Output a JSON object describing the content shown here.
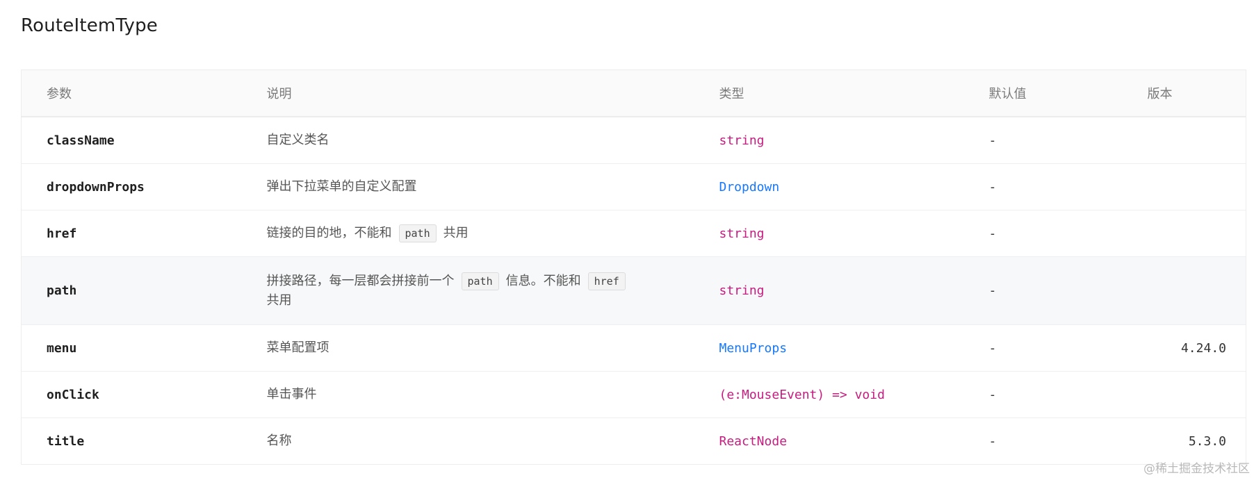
{
  "title": "RouteItemType",
  "colors": {
    "type_purple": "#c41d7f",
    "type_blue": "#1677ff",
    "header_bg": "#fafafa",
    "highlight_row_bg": "#f7f8f9"
  },
  "table": {
    "headers": {
      "param": "参数",
      "description": "说明",
      "type": "类型",
      "default": "默认值",
      "version": "版本"
    },
    "rows": [
      {
        "param": "className",
        "description": "自定义类名",
        "type": "string",
        "type_color": "#c41d7f",
        "default": "-",
        "version": ""
      },
      {
        "param": "dropdownProps",
        "description": "弹出下拉菜单的自定义配置",
        "type": "Dropdown",
        "type_color": "#1677ff",
        "default": "-",
        "version": ""
      },
      {
        "param": "href",
        "description_before": "链接的目的地，不能和",
        "description_code": "path",
        "description_after": "共用",
        "type": "string",
        "type_color": "#c41d7f",
        "default": "-",
        "version": ""
      },
      {
        "param": "path",
        "description_before": "拼接路径，每一层都会拼接前一个",
        "description_code": "path",
        "description_middle": "信息。不能和",
        "description_code2": "href",
        "description_after": "共用",
        "type": "string",
        "type_color": "#c41d7f",
        "default": "-",
        "version": ""
      },
      {
        "param": "menu",
        "description": "菜单配置项",
        "type": "MenuProps",
        "type_color": "#1677ff",
        "default": "-",
        "version": "4.24.0"
      },
      {
        "param": "onClick",
        "description": "单击事件",
        "type": "(e:MouseEvent) => void",
        "type_color": "#c41d7f",
        "default": "-",
        "version": ""
      },
      {
        "param": "title",
        "description": "名称",
        "type": "ReactNode",
        "type_color": "#c41d7f",
        "default": "-",
        "version": "5.3.0"
      }
    ]
  },
  "watermark": "@稀土掘金技术社区"
}
